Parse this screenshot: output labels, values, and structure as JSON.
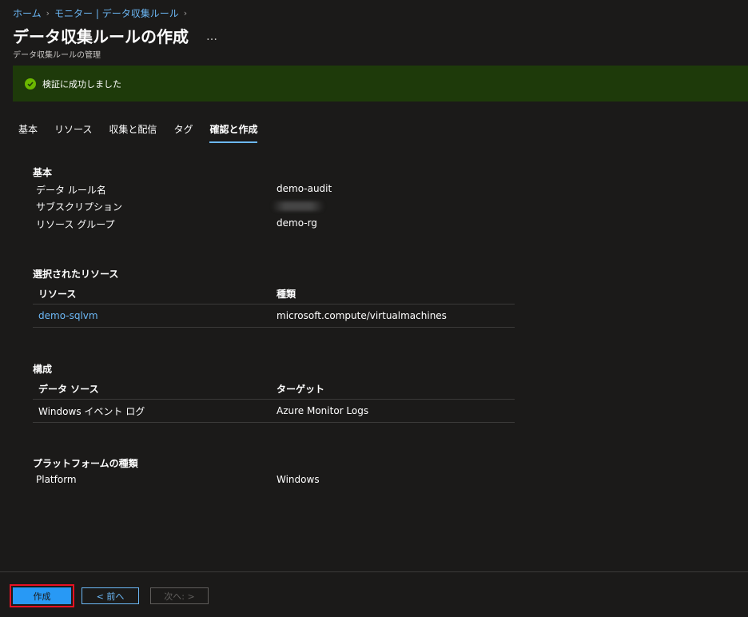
{
  "breadcrumb": {
    "home": "ホーム",
    "monitor": "モニター | データ収集ルール"
  },
  "header": {
    "title": "データ収集ルールの作成",
    "more": "…",
    "subtitle": "データ収集ルールの管理"
  },
  "banner": {
    "icon": "check-circle-icon",
    "text": "検証に成功しました",
    "color": "#1e3a0a"
  },
  "tabs": [
    {
      "label": "基本"
    },
    {
      "label": "リソース"
    },
    {
      "label": "収集と配信"
    },
    {
      "label": "タグ"
    },
    {
      "label": "確認と作成"
    }
  ],
  "basics": {
    "title": "基本",
    "rows": [
      {
        "label": "データ ルール名",
        "value": "demo-audit"
      },
      {
        "label": "サブスクリプション",
        "value": ""
      },
      {
        "label": "リソース グループ",
        "value": "demo-rg"
      }
    ]
  },
  "resources": {
    "title": "選択されたリソース",
    "headers": [
      "リソース",
      "種類"
    ],
    "rows": [
      {
        "name": "demo-sqlvm",
        "type": "microsoft.compute/virtualmachines"
      }
    ]
  },
  "config": {
    "title": "構成",
    "headers": [
      "データ ソース",
      "ターゲット"
    ],
    "rows": [
      {
        "source": "Windows イベント ログ",
        "target": "Azure Monitor Logs"
      }
    ]
  },
  "platform": {
    "title": "プラットフォームの種類",
    "label": "Platform",
    "value": "Windows"
  },
  "footer": {
    "create": "作成",
    "previous": "< 前へ",
    "next": "次へ: >"
  },
  "colors": {
    "accent": "#2899f5",
    "link": "#6cb8f6",
    "success": "#6bb700",
    "highlight_border": "#e81123"
  }
}
